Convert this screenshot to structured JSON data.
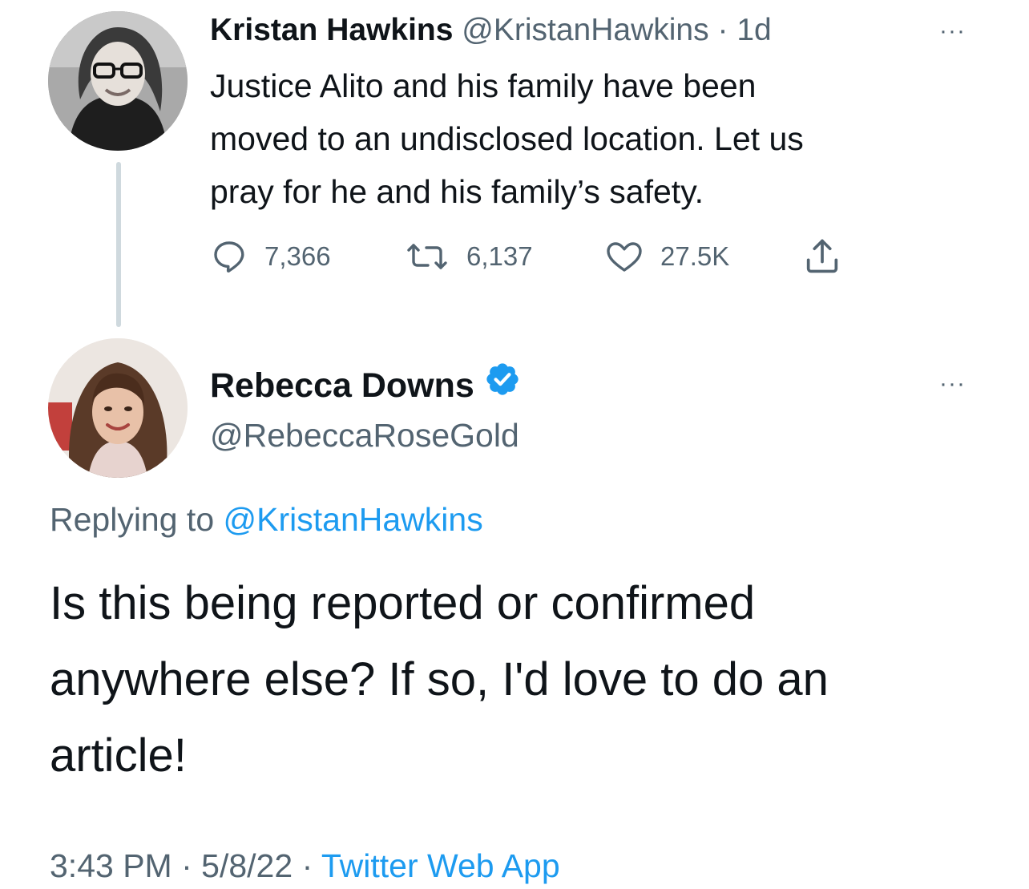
{
  "parent_tweet": {
    "author_name": "Kristan Hawkins",
    "handle": "@KristanHawkins",
    "separator": "·",
    "time_ago": "1d",
    "more_label": "···",
    "text_lines": [
      "Justice Alito and his family have been",
      "moved to an undisclosed location. Let us",
      "pray for he and his family’s safety."
    ],
    "actions": {
      "replies": "7,366",
      "retweets": "6,137",
      "likes": "27.5K"
    },
    "icons": [
      "reply-icon",
      "retweet-icon",
      "like-icon",
      "share-icon"
    ]
  },
  "reply_tweet": {
    "author_name": "Rebecca Downs",
    "verified": true,
    "handle": "@RebeccaRoseGold",
    "more_label": "···",
    "replying_prefix": "Replying to",
    "replying_to": "@KristanHawkins",
    "text_lines": [
      "Is this being reported or confirmed",
      "anywhere else? If so, I'd love to do an",
      "article!"
    ],
    "time": "3:43 PM",
    "separator": "·",
    "date": "5/8/22",
    "source": "Twitter Web App"
  },
  "colors": {
    "text_primary": "#0f1419",
    "text_secondary": "#536471",
    "link": "#1d9bf0",
    "thread_line": "#cfd9de"
  }
}
